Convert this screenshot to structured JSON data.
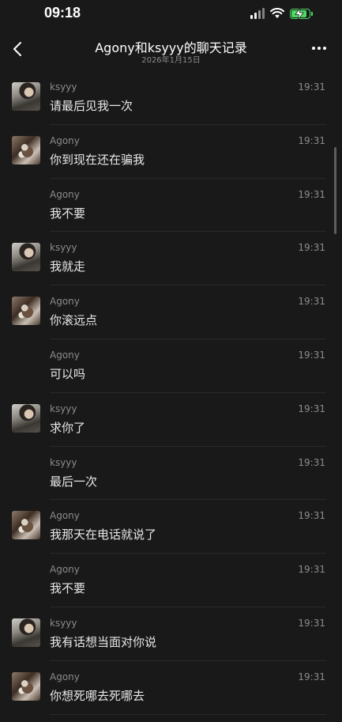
{
  "status_bar": {
    "time": "09:18",
    "accent_color": "#4cd964"
  },
  "header": {
    "title": "Agony和ksyyy的聊天记录",
    "subtitle": "2026年1月15日",
    "back_icon": "chevron-left-icon",
    "more_icon": "more-dots-icon"
  },
  "messages": [
    {
      "sender": "ksyyy",
      "time": "19:31",
      "text": "请最后见我一次",
      "avatar": "ksyyy"
    },
    {
      "sender": "Agony",
      "time": "19:31",
      "text": "你到现在还在骗我",
      "avatar": "agony"
    },
    {
      "sender": "Agony",
      "time": "19:31",
      "text": "我不要",
      "avatar": ""
    },
    {
      "sender": "ksyyy",
      "time": "19:31",
      "text": "我就走",
      "avatar": "ksyyy"
    },
    {
      "sender": "Agony",
      "time": "19:31",
      "text": "你滚远点",
      "avatar": "agony"
    },
    {
      "sender": "Agony",
      "time": "19:31",
      "text": "可以吗",
      "avatar": ""
    },
    {
      "sender": "ksyyy",
      "time": "19:31",
      "text": "求你了",
      "avatar": "ksyyy"
    },
    {
      "sender": "ksyyy",
      "time": "19:31",
      "text": "最后一次",
      "avatar": ""
    },
    {
      "sender": "Agony",
      "time": "19:31",
      "text": "我那天在电话就说了",
      "avatar": "agony"
    },
    {
      "sender": "Agony",
      "time": "19:31",
      "text": "我不要",
      "avatar": ""
    },
    {
      "sender": "ksyyy",
      "time": "19:31",
      "text": "我有话想当面对你说",
      "avatar": "ksyyy"
    },
    {
      "sender": "Agony",
      "time": "19:31",
      "text": "你想死哪去死哪去",
      "avatar": "agony"
    }
  ]
}
